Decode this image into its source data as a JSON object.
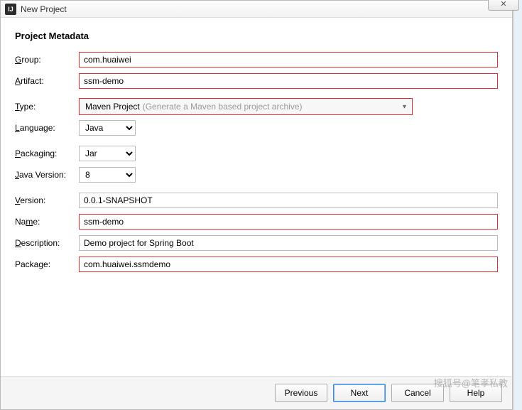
{
  "window": {
    "title": "New Project",
    "close_glyph": "✕"
  },
  "section_title": "Project Metadata",
  "labels": {
    "group": "Group:",
    "artifact": "Artifact:",
    "type": "Type:",
    "language": "Language:",
    "packaging": "Packaging:",
    "java_version": "Java Version:",
    "version": "Version:",
    "name": "Name:",
    "description": "Description:",
    "package": "Package:"
  },
  "mnemonics": {
    "group": "G",
    "artifact": "A",
    "type": "T",
    "language": "L",
    "packaging": "P",
    "java_version": "J",
    "version": "V",
    "name": "m",
    "description": "D",
    "package": "g"
  },
  "fields": {
    "group": "com.huaiwei",
    "artifact": "ssm-demo",
    "type_value": "Maven Project",
    "type_hint": "(Generate a Maven based project archive)",
    "language": "Java",
    "packaging": "Jar",
    "java_version": "8",
    "version": "0.0.1-SNAPSHOT",
    "name": "ssm-demo",
    "description": "Demo project for Spring Boot",
    "package": "com.huaiwei.ssmdemo"
  },
  "buttons": {
    "previous": "Previous",
    "next": "Next",
    "cancel": "Cancel",
    "help": "Help"
  },
  "watermark": "搜狐号@笔孝私教"
}
